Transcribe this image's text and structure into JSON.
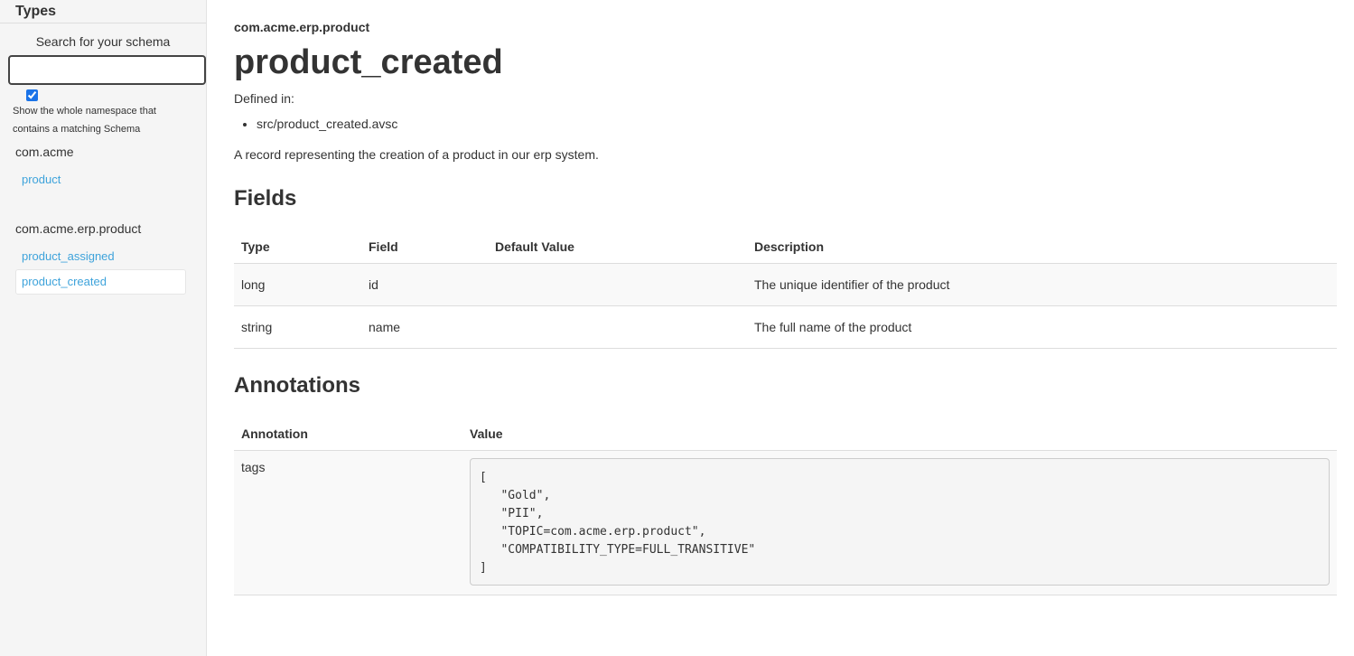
{
  "sidebar": {
    "title": "Types",
    "search_label": "Search for your schema",
    "search_value": "",
    "checkbox_checked": true,
    "checkbox_label": "Show the whole namespace that contains a matching Schema",
    "groups": [
      {
        "name": "com.acme",
        "items": [
          "product"
        ]
      },
      {
        "name": "com.acme.erp.product",
        "items": [
          "product_assigned",
          "product_created"
        ]
      }
    ],
    "active_item": "product_created"
  },
  "main": {
    "namespace": "com.acme.erp.product",
    "title": "product_created",
    "defined_in_label": "Defined in:",
    "defined_in": [
      "src/product_created.avsc"
    ],
    "description": "A record representing the creation of a product in our erp system.",
    "fields_heading": "Fields",
    "fields_columns": [
      "Type",
      "Field",
      "Default Value",
      "Description"
    ],
    "fields_rows": [
      [
        "long",
        "id",
        "",
        "The unique identifier of the product"
      ],
      [
        "string",
        "name",
        "",
        "The full name of the product"
      ]
    ],
    "annotations_heading": "Annotations",
    "annotations_columns": [
      "Annotation",
      "Value"
    ],
    "annotations_rows": [
      {
        "annotation": "tags",
        "value": "[\n   \"Gold\",\n   \"PII\",\n   \"TOPIC=com.acme.erp.product\",\n   \"COMPATIBILITY_TYPE=FULL_TRANSITIVE\"\n]"
      }
    ]
  },
  "colors": {
    "link": "#3ea3db",
    "sidebar_bg": "#f5f5f5",
    "stripe": "#f9f9f9"
  }
}
